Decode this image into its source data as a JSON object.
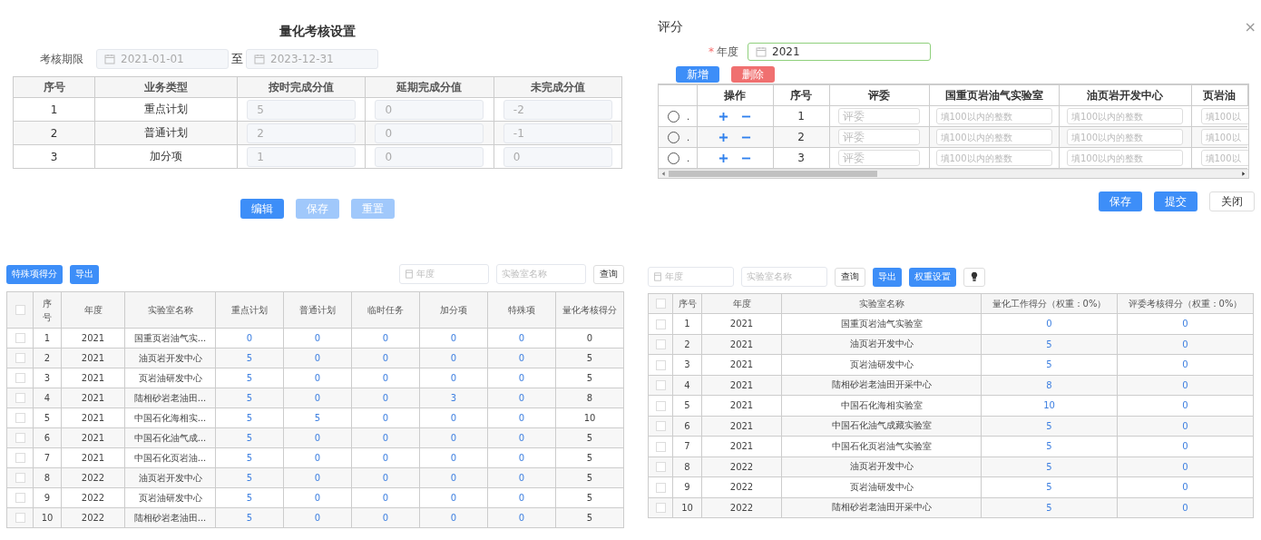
{
  "settings": {
    "title": "量化考核设置",
    "period_label": "考核期限",
    "start_date": "2021-01-01",
    "separator": "至",
    "end_date": "2023-12-31",
    "columns": [
      "序号",
      "业务类型",
      "按时完成分值",
      "延期完成分值",
      "未完成分值"
    ],
    "rows": [
      {
        "index": "1",
        "type": "重点计划",
        "values": [
          "5",
          "0",
          "-2"
        ]
      },
      {
        "index": "2",
        "type": "普通计划",
        "values": [
          "2",
          "0",
          "-1"
        ]
      },
      {
        "index": "3",
        "type": "加分项",
        "values": [
          "1",
          "0",
          "0"
        ]
      }
    ],
    "buttons": [
      {
        "label": "编辑",
        "disabled": false
      },
      {
        "label": "保存",
        "disabled": true
      },
      {
        "label": "重置",
        "disabled": true
      }
    ]
  },
  "dialog": {
    "title": "评分",
    "close": "×",
    "required_mark": "*",
    "year_label": "年度",
    "year_value": "2021",
    "actions": [
      {
        "label": "新增",
        "kind": "primary"
      },
      {
        "label": "删除",
        "kind": "danger"
      }
    ],
    "columns": [
      "",
      "操作",
      "序号",
      "评委",
      "国重页岩油气实验室",
      "油页岩开发中心",
      "页岩油"
    ],
    "rows": [
      {
        "selected": false,
        "marker": ".",
        "index": "1",
        "reviewer_placeholder": "评委",
        "score_placeholders": [
          "填100以内的整数",
          "填100以内的整数",
          "填100以"
        ]
      },
      {
        "selected": false,
        "marker": ".",
        "index": "2",
        "reviewer_placeholder": "评委",
        "score_placeholders": [
          "填100以内的整数",
          "填100以内的整数",
          "填100以"
        ]
      },
      {
        "selected": false,
        "marker": ".",
        "index": "3",
        "reviewer_placeholder": "评委",
        "score_placeholders": [
          "填100以内的整数",
          "填100以内的整数",
          "填100以"
        ]
      }
    ],
    "footer": [
      {
        "label": "保存",
        "kind": "primary"
      },
      {
        "label": "提交",
        "kind": "primary"
      },
      {
        "label": "关闭",
        "kind": "default"
      }
    ]
  },
  "scores": {
    "buttons": [
      {
        "label": "特殊项得分",
        "kind": "primary"
      },
      {
        "label": "导出",
        "kind": "primary"
      }
    ],
    "year_placeholder": "年度",
    "lab_placeholder": "实验室名称",
    "query": "查询",
    "header_checked": false,
    "columns": [
      "序号",
      "年度",
      "实验室名称",
      "重点计划",
      "普通计划",
      "临时任务",
      "加分项",
      "特殊项",
      "量化考核得分"
    ],
    "rows": [
      {
        "checked": false,
        "index": "1",
        "year": "2021",
        "lab": "国重页岩油气实...",
        "values": [
          "0",
          "0",
          "0",
          "0",
          "0"
        ],
        "total": "0"
      },
      {
        "checked": false,
        "index": "2",
        "year": "2021",
        "lab": "油页岩开发中心",
        "values": [
          "5",
          "0",
          "0",
          "0",
          "0"
        ],
        "total": "5"
      },
      {
        "checked": false,
        "index": "3",
        "year": "2021",
        "lab": "页岩油研发中心",
        "values": [
          "5",
          "0",
          "0",
          "0",
          "0"
        ],
        "total": "5"
      },
      {
        "checked": false,
        "index": "4",
        "year": "2021",
        "lab": "陆相砂岩老油田...",
        "values": [
          "5",
          "0",
          "0",
          "3",
          "0"
        ],
        "total": "8"
      },
      {
        "checked": false,
        "index": "5",
        "year": "2021",
        "lab": "中国石化海相实...",
        "values": [
          "5",
          "5",
          "0",
          "0",
          "0"
        ],
        "total": "10"
      },
      {
        "checked": false,
        "index": "6",
        "year": "2021",
        "lab": "中国石化油气成...",
        "values": [
          "5",
          "0",
          "0",
          "0",
          "0"
        ],
        "total": "5"
      },
      {
        "checked": false,
        "index": "7",
        "year": "2021",
        "lab": "中国石化页岩油...",
        "values": [
          "5",
          "0",
          "0",
          "0",
          "0"
        ],
        "total": "5"
      },
      {
        "checked": false,
        "index": "8",
        "year": "2022",
        "lab": "油页岩开发中心",
        "values": [
          "5",
          "0",
          "0",
          "0",
          "0"
        ],
        "total": "5"
      },
      {
        "checked": false,
        "index": "9",
        "year": "2022",
        "lab": "页岩油研发中心",
        "values": [
          "5",
          "0",
          "0",
          "0",
          "0"
        ],
        "total": "5"
      },
      {
        "checked": false,
        "index": "10",
        "year": "2022",
        "lab": "陆相砂岩老油田...",
        "values": [
          "5",
          "0",
          "0",
          "0",
          "0"
        ],
        "total": "5"
      }
    ]
  },
  "summary": {
    "year_placeholder": "年度",
    "lab_placeholder": "实验室名称",
    "buttons": [
      {
        "label": "查询",
        "kind": "default"
      },
      {
        "label": "导出",
        "kind": "primary"
      },
      {
        "label": "权重设置",
        "kind": "primary"
      }
    ],
    "header_checked": false,
    "columns": [
      "序号",
      "年度",
      "实验室名称",
      "量化工作得分（权重：0%）",
      "评委考核得分（权重：0%）"
    ],
    "rows": [
      {
        "checked": false,
        "index": "1",
        "year": "2021",
        "lab": "国重页岩油气实验室",
        "values": [
          "0",
          "0"
        ]
      },
      {
        "checked": false,
        "index": "2",
        "year": "2021",
        "lab": "油页岩开发中心",
        "values": [
          "5",
          "0"
        ]
      },
      {
        "checked": false,
        "index": "3",
        "year": "2021",
        "lab": "页岩油研发中心",
        "values": [
          "5",
          "0"
        ]
      },
      {
        "checked": false,
        "index": "4",
        "year": "2021",
        "lab": "陆相砂岩老油田开采中心",
        "values": [
          "8",
          "0"
        ]
      },
      {
        "checked": false,
        "index": "5",
        "year": "2021",
        "lab": "中国石化海相实验室",
        "values": [
          "10",
          "0"
        ]
      },
      {
        "checked": false,
        "index": "6",
        "year": "2021",
        "lab": "中国石化油气成藏实验室",
        "values": [
          "5",
          "0"
        ]
      },
      {
        "checked": false,
        "index": "7",
        "year": "2021",
        "lab": "中国石化页岩油气实验室",
        "values": [
          "5",
          "0"
        ]
      },
      {
        "checked": false,
        "index": "8",
        "year": "2022",
        "lab": "油页岩开发中心",
        "values": [
          "5",
          "0"
        ]
      },
      {
        "checked": false,
        "index": "9",
        "year": "2022",
        "lab": "页岩油研发中心",
        "values": [
          "5",
          "0"
        ]
      },
      {
        "checked": false,
        "index": "10",
        "year": "2022",
        "lab": "陆相砂岩老油田开采中心",
        "values": [
          "5",
          "0"
        ]
      }
    ]
  }
}
